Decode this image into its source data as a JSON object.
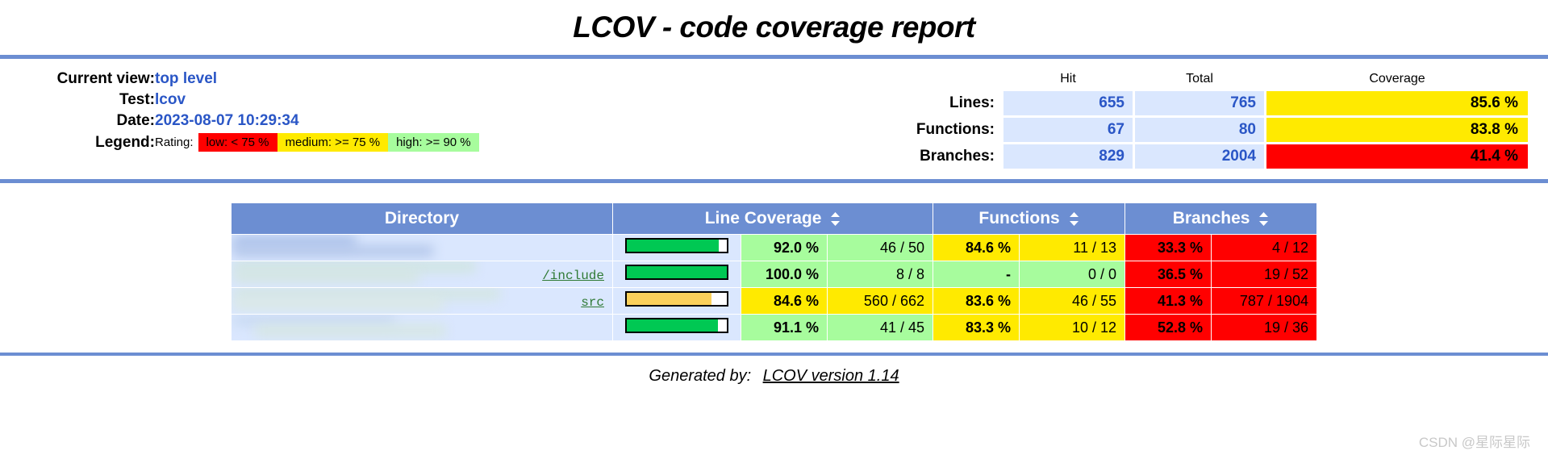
{
  "page": {
    "title": "LCOV - code coverage report",
    "colors": {
      "accent_blue": "#6c8ed2",
      "link_blue": "#2a56c6",
      "cell_blue": "#dae7fe",
      "high_green": "#a7fc9d",
      "medium_yellow": "#ffea00",
      "low_red": "#ff0000",
      "bar_green": "#00c853",
      "bar_amber": "#fbd15b"
    }
  },
  "info": {
    "current_view_label": "Current view:",
    "current_view_value": "top level",
    "test_label": "Test:",
    "test_value": "lcov",
    "date_label": "Date:",
    "date_value": "2023-08-07 10:29:34",
    "legend_label": "Legend:",
    "rating_label": "Rating:",
    "legend": [
      {
        "text": "low: < 75 %",
        "color": "#ff0000"
      },
      {
        "text": "medium: >= 75 %",
        "color": "#ffea00"
      },
      {
        "text": "high: >= 90 %",
        "color": "#a7fc9d"
      }
    ]
  },
  "summary": {
    "columns": [
      "Hit",
      "Total",
      "Coverage"
    ],
    "rows": [
      {
        "label": "Lines:",
        "hit": "655",
        "total": "765",
        "coverage": "85.6 %",
        "rating": "medium"
      },
      {
        "label": "Functions:",
        "hit": "67",
        "total": "80",
        "coverage": "83.8 %",
        "rating": "medium"
      },
      {
        "label": "Branches:",
        "hit": "829",
        "total": "2004",
        "coverage": "41.4 %",
        "rating": "low"
      }
    ]
  },
  "coverage_table": {
    "headers": {
      "directory": "Directory",
      "line_coverage": "Line Coverage",
      "functions": "Functions",
      "branches": "Branches"
    },
    "rows": [
      {
        "directory": "",
        "line_pct": "92.0 %",
        "line_ratio": "46 / 50",
        "line_value": 92.0,
        "line_rating": "high",
        "func_pct": "84.6 %",
        "func_ratio": "11 / 13",
        "func_rating": "medium",
        "branch_pct": "33.3 %",
        "branch_ratio": "4 / 12",
        "branch_rating": "low"
      },
      {
        "directory": "/include",
        "line_pct": "100.0 %",
        "line_ratio": "8 / 8",
        "line_value": 100.0,
        "line_rating": "high",
        "func_pct": "-",
        "func_ratio": "0 / 0",
        "func_rating": "high",
        "branch_pct": "36.5 %",
        "branch_ratio": "19 / 52",
        "branch_rating": "low"
      },
      {
        "directory": "src",
        "line_pct": "84.6 %",
        "line_ratio": "560 / 662",
        "line_value": 84.6,
        "line_rating": "medium",
        "func_pct": "83.6 %",
        "func_ratio": "46 / 55",
        "func_rating": "medium",
        "branch_pct": "41.3 %",
        "branch_ratio": "787 / 1904",
        "branch_rating": "low"
      },
      {
        "directory": "",
        "line_pct": "91.1 %",
        "line_ratio": "41 / 45",
        "line_value": 91.1,
        "line_rating": "high",
        "func_pct": "83.3 %",
        "func_ratio": "10 / 12",
        "func_rating": "medium",
        "branch_pct": "52.8 %",
        "branch_ratio": "19 / 36",
        "branch_rating": "low"
      }
    ]
  },
  "footer": {
    "generated_by": "Generated by:",
    "version_link": "LCOV version 1.14",
    "watermark": "CSDN @星际星际"
  }
}
